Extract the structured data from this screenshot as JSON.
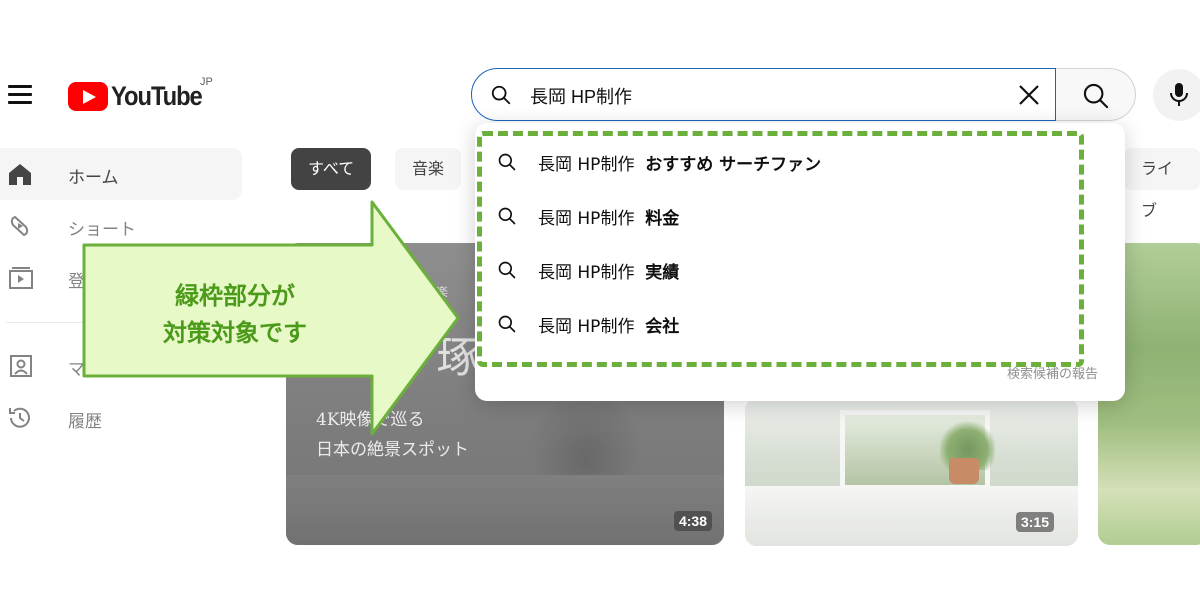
{
  "header": {
    "logo_text": "YouTube",
    "region": "JP",
    "search_value": "長岡 HP制作",
    "icons": [
      "menu-icon",
      "search-icon",
      "clear-icon",
      "microphone-icon"
    ]
  },
  "sidebar": {
    "items": [
      {
        "label": "ホーム",
        "icon": "home-icon",
        "active": true
      },
      {
        "label": "ショート",
        "icon": "shorts-icon"
      },
      {
        "label": "登",
        "icon": "subscriptions-icon"
      },
      {
        "label": "マ",
        "icon": "you-icon"
      },
      {
        "label": "履歴",
        "icon": "history-icon"
      }
    ]
  },
  "chips": [
    "すべて",
    "音楽",
    "ライブ"
  ],
  "suggestions": [
    {
      "query": "長岡 HP制作",
      "extra": "おすすめ サーチファン"
    },
    {
      "query": "長岡 HP制作",
      "extra": "料金"
    },
    {
      "query": "長岡 HP制作",
      "extra": "実績"
    },
    {
      "query": "長岡 HP制作",
      "extra": "会社"
    }
  ],
  "report_link": "検索候補の報告",
  "videos": [
    {
      "overlay_kicker": "楽",
      "overlay_big": "琢",
      "overlay_line1": "4K映像で巡る",
      "overlay_line2": "日本の絶景スポット",
      "duration": "4:38"
    },
    {
      "duration": "3:15"
    }
  ],
  "annotation": {
    "line1": "緑枠部分が",
    "line2": "対策対象です",
    "arrow_color": "#e8f9c8",
    "frame_color": "#6bb03a",
    "text_color": "#4c9a1a"
  },
  "colors": {
    "brand_red": "#ff0000",
    "focus_blue": "#1c62b9",
    "chip_selected": "#0f0f0f"
  }
}
